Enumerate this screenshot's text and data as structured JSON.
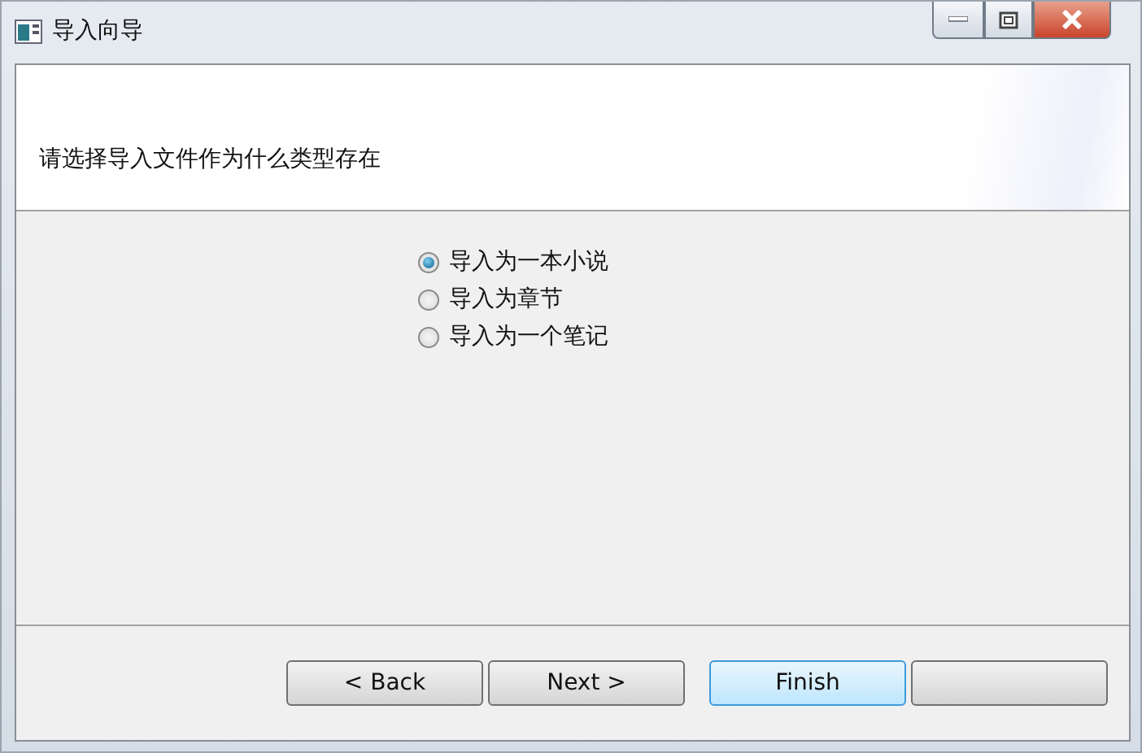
{
  "window": {
    "title": "导入向导"
  },
  "header": {
    "instruction": "请选择导入文件作为什么类型存在"
  },
  "options": [
    {
      "label": "导入为一本小说",
      "selected": true
    },
    {
      "label": "导入为章节",
      "selected": false
    },
    {
      "label": "导入为一个笔记",
      "selected": false
    }
  ],
  "buttons": [
    {
      "label": "< Back",
      "focused": false
    },
    {
      "label": "Next >",
      "focused": false
    },
    {
      "label": "Finish",
      "focused": true
    },
    {
      "focused": false
    }
  ]
}
